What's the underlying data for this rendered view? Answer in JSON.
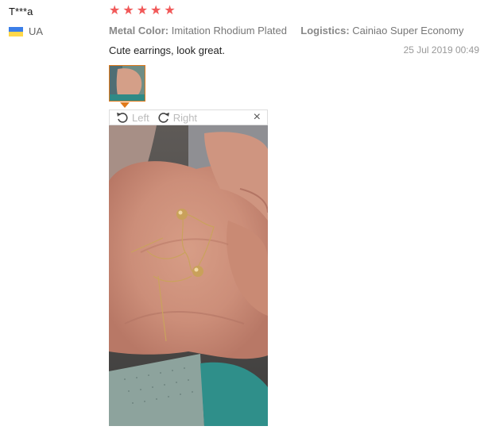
{
  "reviewer": {
    "name": "T***a",
    "country_code": "UA"
  },
  "rating": {
    "stars": 5,
    "max": 5,
    "color": "#f15959"
  },
  "attributes": [
    {
      "key": "Metal Color:",
      "value": "Imitation Rhodium Plated"
    },
    {
      "key": "Logistics:",
      "value": "Cainiao Super Economy"
    }
  ],
  "review": {
    "text": "Cute earrings, look great.",
    "date": "25 Jul 2019 00:49"
  },
  "viewer": {
    "rotate_left_label": "Left",
    "rotate_right_label": "Right",
    "close_symbol": "×"
  },
  "photo": {
    "icons": [
      "rotate-left-icon",
      "rotate-right-icon",
      "close-icon"
    ]
  },
  "colors": {
    "accent": "#e07a1c",
    "star": "#f15959"
  }
}
